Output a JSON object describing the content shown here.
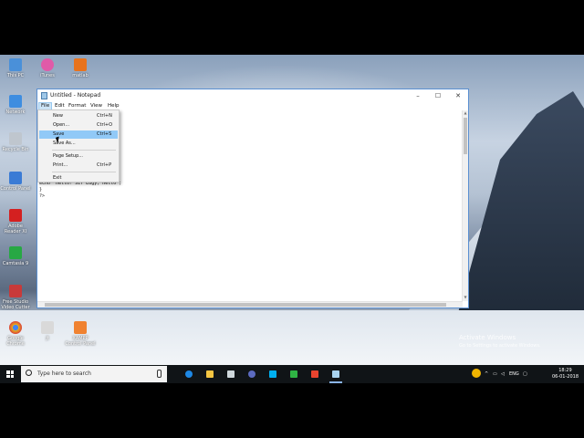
{
  "window": {
    "title": "Untitled - Notepad",
    "minimize": "–",
    "maximize": "☐",
    "close": "✕"
  },
  "menubar": [
    "File",
    "Edit",
    "Format",
    "View",
    "Help"
  ],
  "file_menu": [
    {
      "label": "New",
      "shortcut": "Ctrl+N"
    },
    {
      "label": "Open...",
      "shortcut": "Ctrl+O"
    },
    {
      "label": "Save",
      "shortcut": "Ctrl+S"
    },
    {
      "label": "Save As...",
      "shortcut": ""
    },
    {
      "label": "Page Setup...",
      "shortcut": ""
    },
    {
      "label": "Print...",
      "shortcut": "Ctrl+P"
    },
    {
      "label": "Exit",
      "shortcut": ""
    }
  ],
  "editor_lines": [
    "echo \"Hello! Sir Eugy, Hello\";",
    "}",
    "?>"
  ],
  "desktop_icons": [
    {
      "label": "This PC",
      "color": "#4a90d9"
    },
    {
      "label": "iTunes",
      "color": "#e05aa8"
    },
    {
      "label": "matlab",
      "color": "#e8731d"
    },
    {
      "label": "Network",
      "color": "#3e8de0"
    },
    {
      "label": "Recycle Bin",
      "color": "#bfc6ce"
    },
    {
      "label": "Control Panel",
      "color": "#3a7bd5"
    },
    {
      "label": "Adobe Reader XI",
      "color": "#d42020"
    },
    {
      "label": "Camtasia 9",
      "color": "#27a844"
    },
    {
      "label": "Free Studio Video Cutter",
      "color": "#c83a3a"
    },
    {
      "label": "Google Chrome",
      "color": "#e5b21f"
    },
    {
      "label": "jt",
      "color": "#d9d9d9"
    },
    {
      "label": "XAMPP Control Panel",
      "color": "#f08230"
    }
  ],
  "watermark": {
    "title": "Activate Windows",
    "subtitle": "Go to Settings to activate Windows."
  },
  "taskbar": {
    "search_placeholder": "Type here to search",
    "apps": [
      {
        "icon": "edge-icon",
        "color": "#1e88e5"
      },
      {
        "icon": "file-explorer-icon",
        "color": "#f4c542"
      },
      {
        "icon": "store-icon",
        "color": "#cfd8dc"
      },
      {
        "icon": "infinity-icon",
        "color": "#5c6bc0"
      },
      {
        "icon": "skype-icon",
        "color": "#00aff0"
      },
      {
        "icon": "camtasia-icon",
        "color": "#2fb344"
      },
      {
        "icon": "recorder-icon",
        "color": "#e8442f"
      },
      {
        "icon": "notepad-icon",
        "color": "#a8d3ef"
      }
    ],
    "tray_lang": "ENG",
    "time": "18:29",
    "date": "06-01-2018"
  }
}
